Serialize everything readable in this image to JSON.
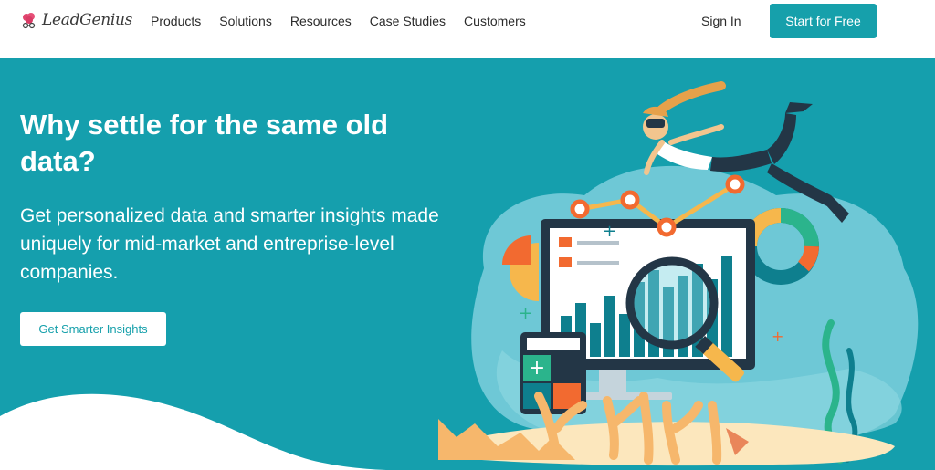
{
  "brand": {
    "name": "LeadGenius",
    "accent": "#16a0ab",
    "hero_bg": "#159fad"
  },
  "nav": {
    "items": [
      "Products",
      "Solutions",
      "Resources",
      "Case Studies",
      "Customers"
    ],
    "sign_in": "Sign In",
    "cta": "Start for Free"
  },
  "hero": {
    "title": "Why settle for the same old data?",
    "subtitle": "Get personalized data and smarter insights made uniquely for mid-market and entreprise-level companies.",
    "button": "Get Smarter Insights"
  },
  "illustration": {
    "icon": "diver-analytics-illustration"
  }
}
